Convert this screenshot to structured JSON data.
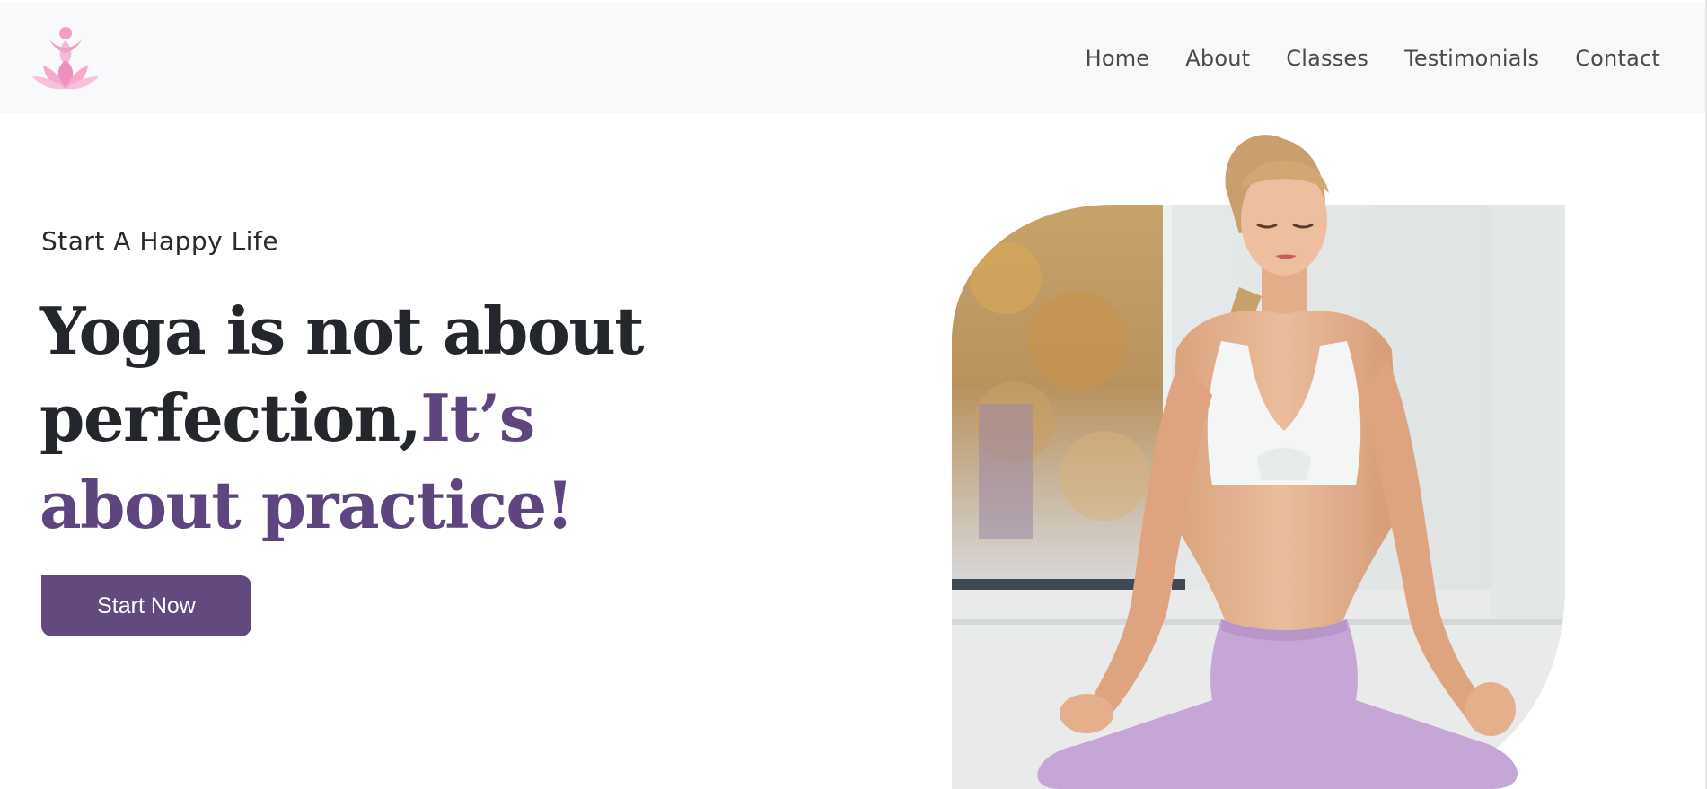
{
  "header": {
    "logo_icon": "lotus-meditation-icon",
    "nav": [
      {
        "label": "Home"
      },
      {
        "label": "About"
      },
      {
        "label": "Classes"
      },
      {
        "label": "Testimonials"
      },
      {
        "label": "Contact"
      }
    ]
  },
  "hero": {
    "tagline": "Start A Happy Life",
    "headline_part1": "Yoga is not about perfection,",
    "headline_part2": "It’s about practice!",
    "cta_label": "Start Now",
    "image_description_icon": "woman-meditating-photo"
  },
  "colors": {
    "accent": "#624a7e",
    "headline": "#23262b",
    "header_bg": "#f8f9fa",
    "logo_pink": "#f29ec8"
  }
}
